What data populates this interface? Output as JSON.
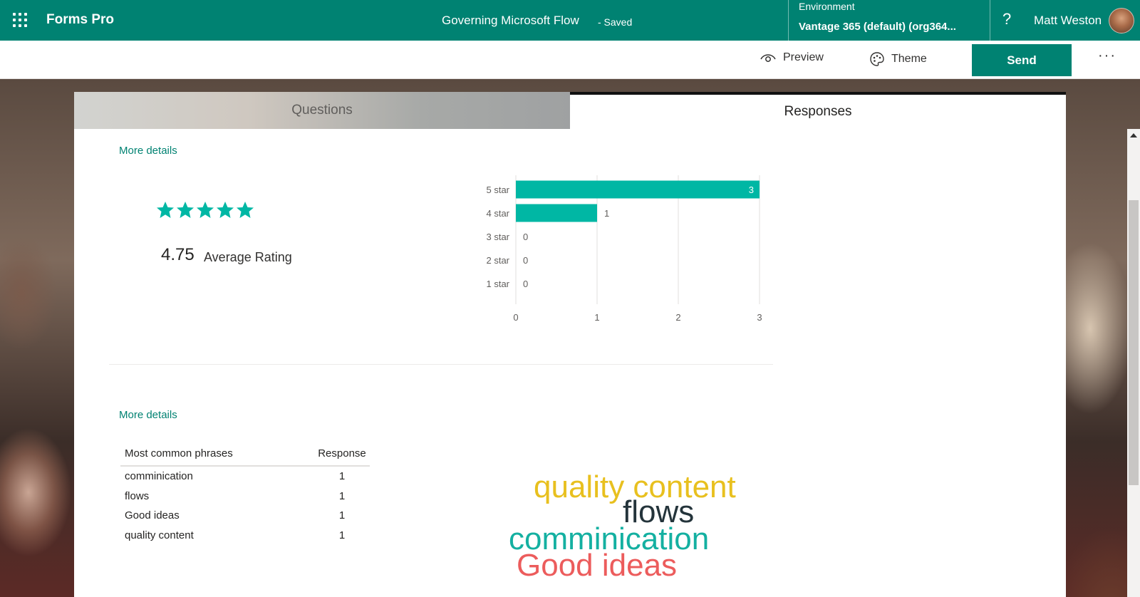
{
  "header": {
    "app_name": "Forms Pro",
    "doc_title": "Governing Microsoft Flow",
    "doc_status": "- Saved",
    "environment_label": "Environment",
    "environment_value": "Vantage 365 (default) (org364...",
    "help": "?",
    "user_name": "Matt Weston"
  },
  "commands": {
    "preview": "Preview",
    "theme": "Theme",
    "send": "Send",
    "more": "···"
  },
  "tabs": [
    {
      "label": "Questions",
      "selected": false
    },
    {
      "label": "Responses",
      "selected": true
    }
  ],
  "rating": {
    "more_details": "More details",
    "average_value": "4.75",
    "average_label": "Average Rating",
    "stars_total": 5,
    "star_color": "#00b7a4"
  },
  "chart_data": {
    "type": "bar",
    "orientation": "horizontal",
    "categories": [
      "5 star",
      "4 star",
      "3 star",
      "2 star",
      "1 star"
    ],
    "values": [
      3,
      1,
      0,
      0,
      0
    ],
    "xlim": [
      0,
      3
    ],
    "xticks": [
      "0",
      "1",
      "2",
      "3"
    ],
    "grid": true,
    "bar_color": "#00b7a4"
  },
  "phrases": {
    "more_details": "More details",
    "headers": [
      "Most common phrases",
      "Response"
    ],
    "rows": [
      [
        "comminication",
        "1"
      ],
      [
        "flows",
        "1"
      ],
      [
        "Good ideas",
        "1"
      ],
      [
        "quality content",
        "1"
      ]
    ]
  },
  "word_cloud": [
    {
      "text": "quality content",
      "color": "#e8c01f"
    },
    {
      "text": "flows",
      "color": "#24343b"
    },
    {
      "text": "comminication",
      "color": "#14b0a1"
    },
    {
      "text": "Good ideas",
      "color": "#ec5c5c"
    }
  ],
  "colors": {
    "brand": "#008272"
  }
}
